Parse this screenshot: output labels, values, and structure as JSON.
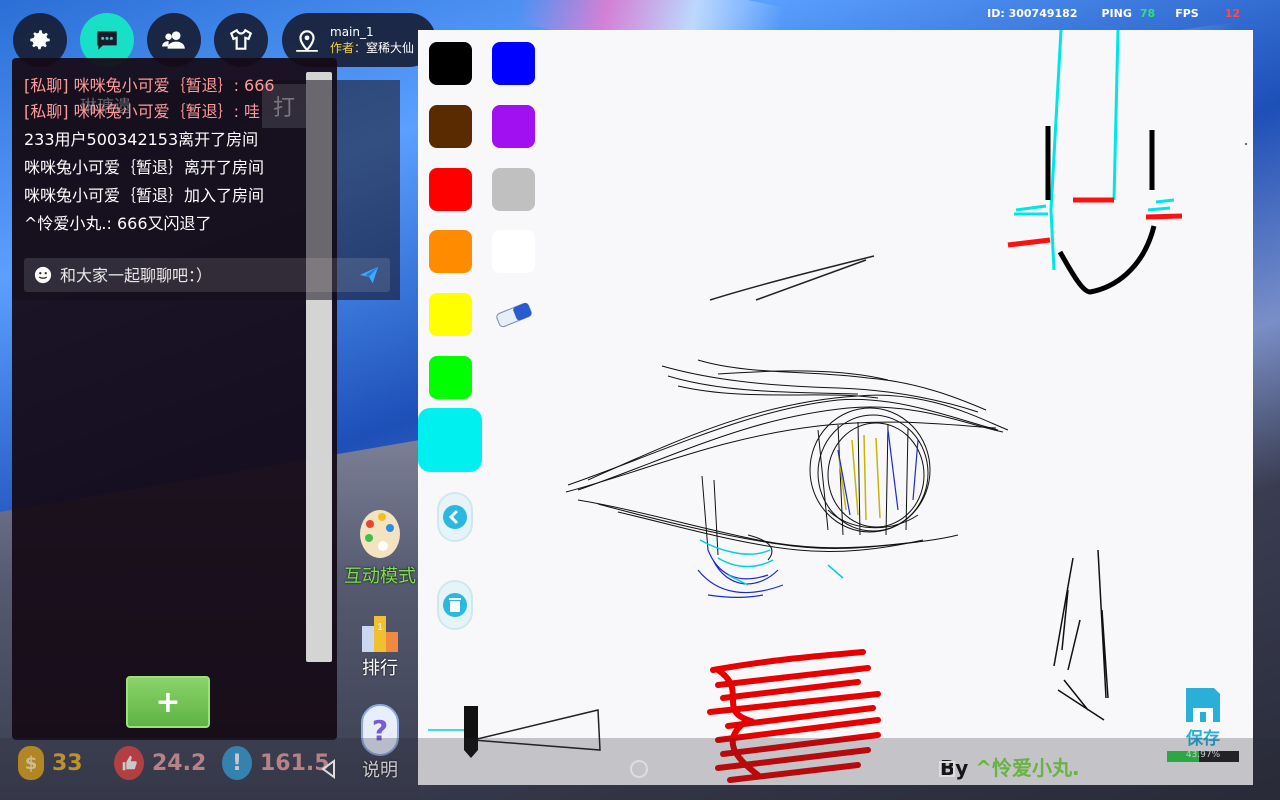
{
  "header": {
    "buttons": [
      {
        "name": "settings",
        "icon": "gear-icon"
      },
      {
        "name": "chat",
        "icon": "chat-bubble-icon",
        "active": true
      },
      {
        "name": "friends",
        "icon": "users-icon"
      },
      {
        "name": "shop",
        "icon": "shirt-icon"
      }
    ],
    "room": {
      "icon": "map-pin-icon",
      "name": "main_1",
      "author_label": "作者：",
      "author_value": "窒稀大仙"
    },
    "stats": {
      "id_label": "ID: 300749182",
      "ping_label": "PING",
      "ping_value": "78",
      "fps_label": "FPS",
      "fps_value": "12"
    }
  },
  "chat": {
    "ghost_text": "琳瑭遗",
    "ghost_button": "打",
    "messages": [
      {
        "text": "[私聊] 咪咪兔小可爱｛暂退｝: 666",
        "private": true
      },
      {
        "text": "[私聊] 咪咪兔小可爱｛暂退｝: 哇",
        "private": true
      },
      {
        "text": "233用户500342153离开了房间",
        "private": false
      },
      {
        "text": "咪咪兔小可爱｛暂退｝离开了房间",
        "private": false
      },
      {
        "text": "咪咪兔小可爱｛暂退｝加入了房间",
        "private": false
      },
      {
        "text": "^怜爱小丸.: 666又闪退了",
        "private": false
      }
    ],
    "input_placeholder": "和大家一起聊聊吧：）",
    "add_label": "+"
  },
  "bottom_stats": {
    "coins": "33",
    "likes": "24.2",
    "reports": "161.5",
    "coin_glyph": "$",
    "warn_glyph": "!"
  },
  "side_tools": {
    "interactive_label": "互动模式",
    "rank_label": "排行",
    "help_label": "说明",
    "help_glyph": "?"
  },
  "palette": {
    "colors": [
      "#000000",
      "#0000ff",
      "#5a2a00",
      "#a010f0",
      "#ff0000",
      "#c0c0c0",
      "#ff8c00",
      "#ffffff",
      "#ffff00",
      "#00ff00"
    ],
    "selected": "#00f0f0",
    "eraser": "eraser-icon",
    "back": "chevron-left-icon",
    "trash": "trash-icon"
  },
  "save": {
    "label": "保存",
    "progress_label": "43.97%",
    "progress_value": 43.97
  },
  "byline": {
    "by": "By",
    "author": "^怜爱小丸."
  }
}
